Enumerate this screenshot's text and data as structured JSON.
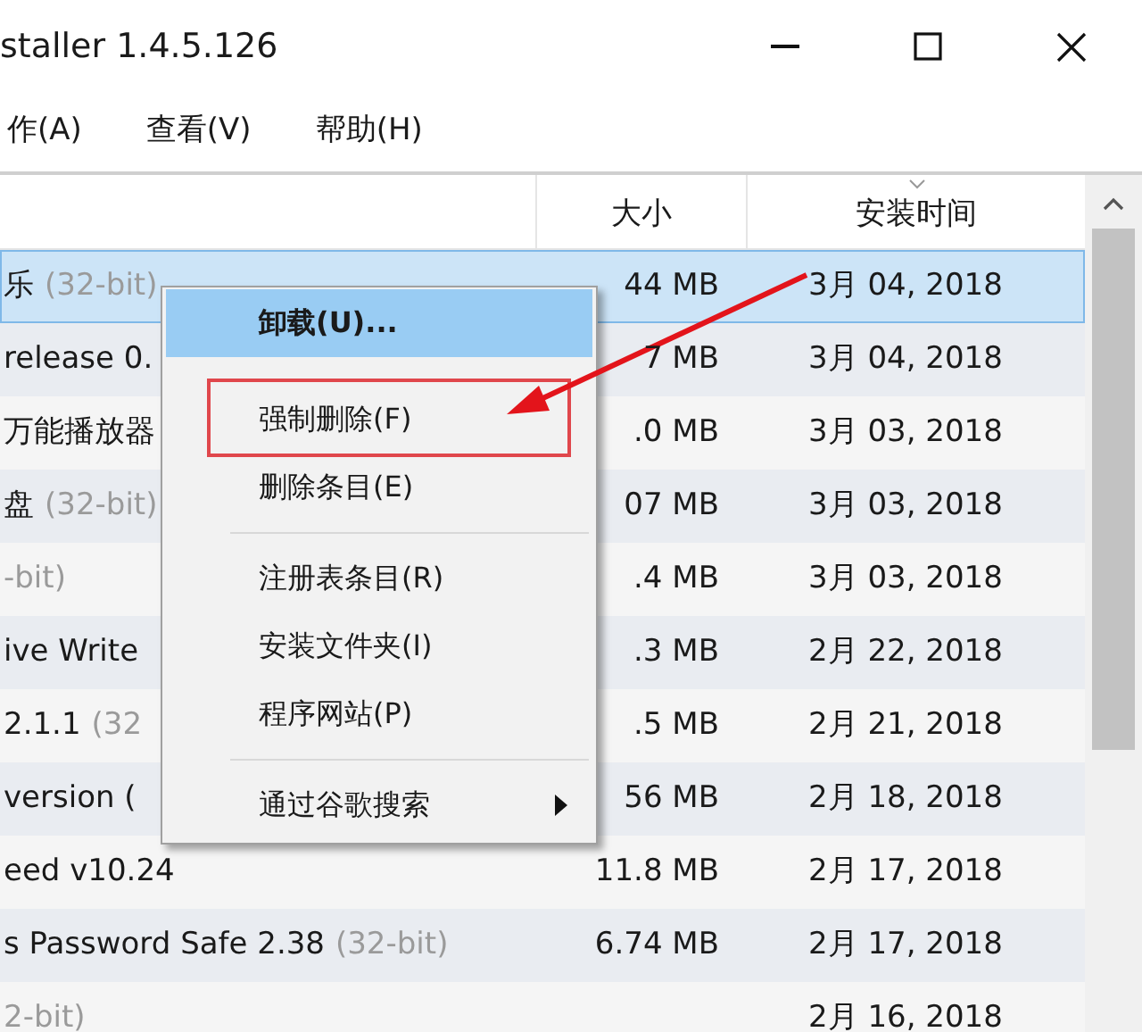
{
  "window": {
    "title": "staller 1.4.5.126"
  },
  "menu_bar": [
    "作(A)",
    "查看(V)",
    "帮助(H)"
  ],
  "table": {
    "columns": [
      {},
      {
        "label": "大小"
      },
      {
        "label": "安装时间",
        "sorted": true
      }
    ],
    "rows": [
      {
        "name": "乐",
        "suffix": "(32-bit)",
        "size": "44 MB",
        "date": "3月 04, 2018",
        "selected": true
      },
      {
        "name": "release 0.",
        "size": "7 MB",
        "date": "3月 04, 2018",
        "selected": false
      },
      {
        "name": "万能播放器",
        "size": ".0 MB",
        "date": "3月 03, 2018",
        "selected": false
      },
      {
        "name": "盘",
        "suffix": "(32-bit)",
        "size": "07 MB",
        "date": "3月 03, 2018",
        "selected": false
      },
      {
        "suffix": "-bit)",
        "size": ".4 MB",
        "date": "3月 03, 2018",
        "selected": false
      },
      {
        "name": "ive Write",
        "size": ".3 MB",
        "date": "2月 22, 2018",
        "selected": false
      },
      {
        "name": "2.1.1",
        "suffix": "(32",
        "size": ".5 MB",
        "date": "2月 21, 2018",
        "selected": false
      },
      {
        "name": "version (",
        "size": "56 MB",
        "date": "2月 18, 2018",
        "selected": false
      },
      {
        "name": "eed v10.24",
        "size": "11.8 MB",
        "date": "2月 17, 2018",
        "selected": false
      },
      {
        "name": "s Password Safe 2.38",
        "suffix": "(32-bit)",
        "size": "6.74 MB",
        "date": "2月 17, 2018",
        "selected": false
      },
      {
        "suffix": "2-bit)",
        "date": "2月 16, 2018",
        "selected": false
      }
    ]
  },
  "context_menu": {
    "items": [
      {
        "kind": "item",
        "label": "卸载(U)...",
        "selected": true,
        "bold": true,
        "highlighted_annotation": false
      },
      {
        "kind": "item",
        "label": "强制删除(F)",
        "selected": false,
        "bold": false,
        "highlighted_annotation": true
      },
      {
        "kind": "item",
        "label": "删除条目(E)",
        "selected": false,
        "bold": false,
        "highlighted_annotation": false
      },
      {
        "kind": "separator"
      },
      {
        "kind": "item",
        "label": "注册表条目(R)",
        "selected": false,
        "bold": false,
        "highlighted_annotation": false
      },
      {
        "kind": "item",
        "label": "安装文件夹(I)",
        "selected": false,
        "bold": false,
        "highlighted_annotation": false
      },
      {
        "kind": "item",
        "label": "程序网站(P)",
        "selected": false,
        "bold": false,
        "highlighted_annotation": false
      },
      {
        "kind": "separator"
      },
      {
        "kind": "item",
        "label": "通过谷歌搜索",
        "selected": false,
        "bold": false,
        "highlighted_annotation": false,
        "submenu": true
      }
    ]
  }
}
